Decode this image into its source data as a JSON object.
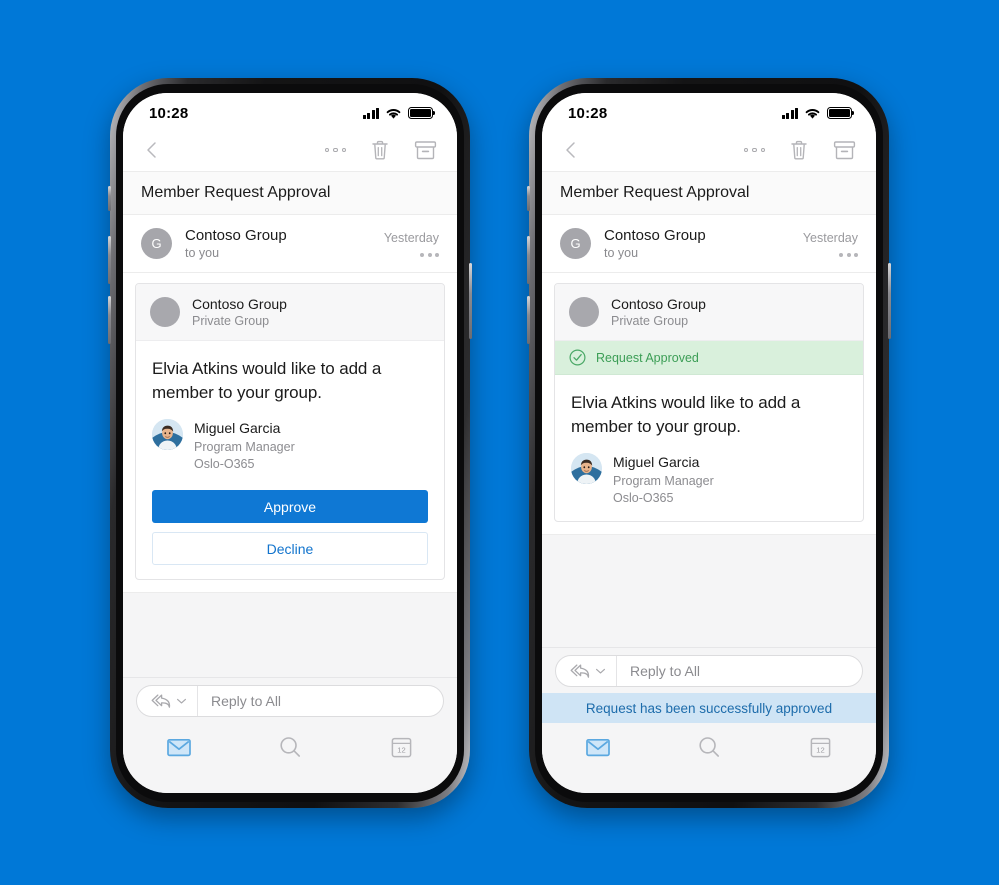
{
  "page": {
    "background_color": "#0078d7",
    "accent_color": "#0f78d4",
    "success_color": "#3c9e56",
    "toast_color": "#1d6cab"
  },
  "shared": {
    "status_bar": {
      "time": "10:28",
      "cellular_icon": "cellular-signal-icon",
      "wifi_icon": "wifi-icon",
      "battery_icon": "battery-full-icon"
    },
    "toolbar": {
      "back_icon": "chevron-left-icon",
      "more_icon": "more-options-icon",
      "delete_icon": "trash-icon",
      "archive_icon": "archive-icon"
    },
    "subject": "Member Request Approval",
    "sender": {
      "avatar_initial": "G",
      "name": "Contoso Group",
      "recipient": "to you",
      "date": "Yesterday",
      "more_icon": "more-options-icon"
    },
    "card": {
      "group_name": "Contoso Group",
      "group_type": "Private Group",
      "title": "Elvia Atkins would like to add a member to your group.",
      "person": {
        "name": "Miguel Garcia",
        "role": "Program Manager",
        "location": "Oslo-O365",
        "avatar_icon": "person-photo-avatar"
      },
      "approve_label": "Approve",
      "decline_label": "Decline"
    },
    "reply_bar": {
      "reply_all_icon": "reply-all-icon",
      "chevron_icon": "chevron-down-icon",
      "placeholder": "Reply to All"
    },
    "tab_bar": {
      "tabs": [
        {
          "name": "mail",
          "icon": "mail-icon",
          "active": true
        },
        {
          "name": "search",
          "icon": "search-icon",
          "active": false
        },
        {
          "name": "calendar",
          "icon": "calendar-icon",
          "active": false
        }
      ],
      "calendar_day": "12"
    }
  },
  "phone_left": {
    "state": "pending",
    "card_has_actions": true
  },
  "phone_right": {
    "state": "approved",
    "approved_banner": {
      "icon": "check-circle-icon",
      "label": "Request Approved"
    },
    "toast": "Request has been successfully approved"
  }
}
